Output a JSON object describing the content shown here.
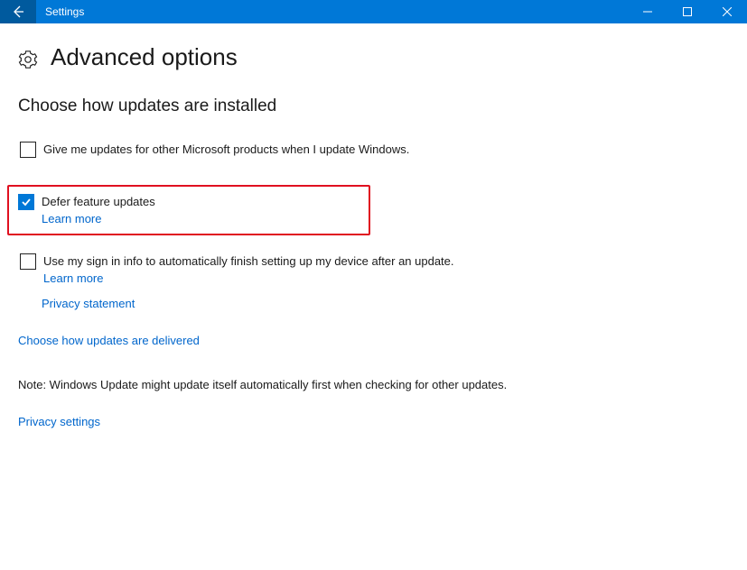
{
  "titlebar": {
    "app_name": "Settings"
  },
  "page": {
    "title": "Advanced options",
    "section_heading": "Choose how updates are installed"
  },
  "options": {
    "ms_products": {
      "label": "Give me updates for other Microsoft products when I update Windows.",
      "checked": false
    },
    "defer": {
      "label": "Defer feature updates",
      "learn_more": "Learn more",
      "checked": true
    },
    "sign_in": {
      "label": "Use my sign in info to automatically finish setting up my device after an update.",
      "learn_more": "Learn more",
      "checked": false
    }
  },
  "links": {
    "privacy_statement": "Privacy statement",
    "choose_delivery": "Choose how updates are delivered",
    "privacy_settings": "Privacy settings"
  },
  "note": "Note: Windows Update might update itself automatically first when checking for other updates."
}
